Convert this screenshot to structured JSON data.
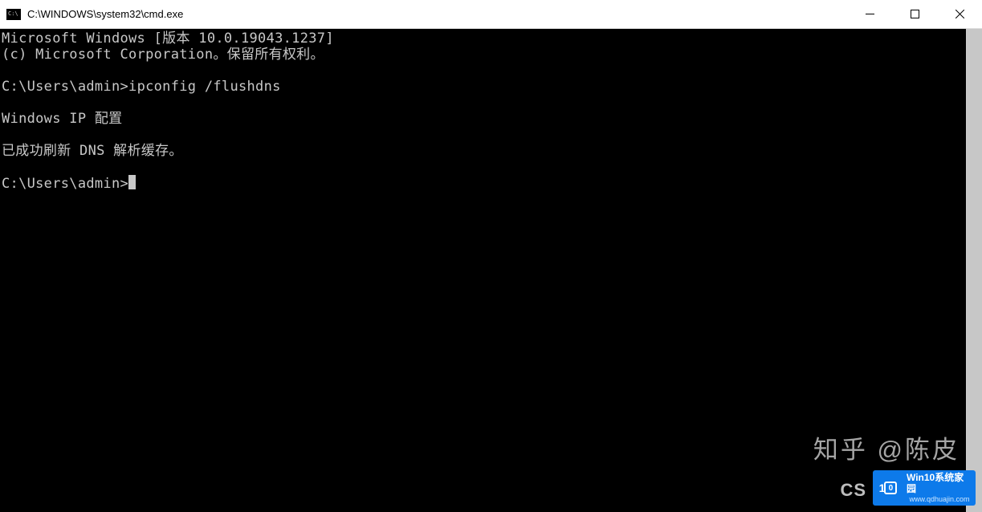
{
  "titlebar": {
    "title": "C:\\WINDOWS\\system32\\cmd.exe"
  },
  "terminal": {
    "line1": "Microsoft Windows [版本 10.0.19043.1237]",
    "line2": "(c) Microsoft Corporation。保留所有权利。",
    "blank1": "",
    "prompt1": "C:\\Users\\admin>",
    "command1": "ipconfig /flushdns",
    "blank2": "",
    "output1": "Windows IP 配置",
    "blank3": "",
    "output2": "已成功刷新 DNS 解析缓存。",
    "blank4": "",
    "prompt2": "C:\\Users\\admin>"
  },
  "watermarks": {
    "zhihu": "知乎 @陈皮",
    "csdn": "CS",
    "badge_main": "Win10系统家园",
    "badge_sub": "www.qdhuajin.com"
  }
}
